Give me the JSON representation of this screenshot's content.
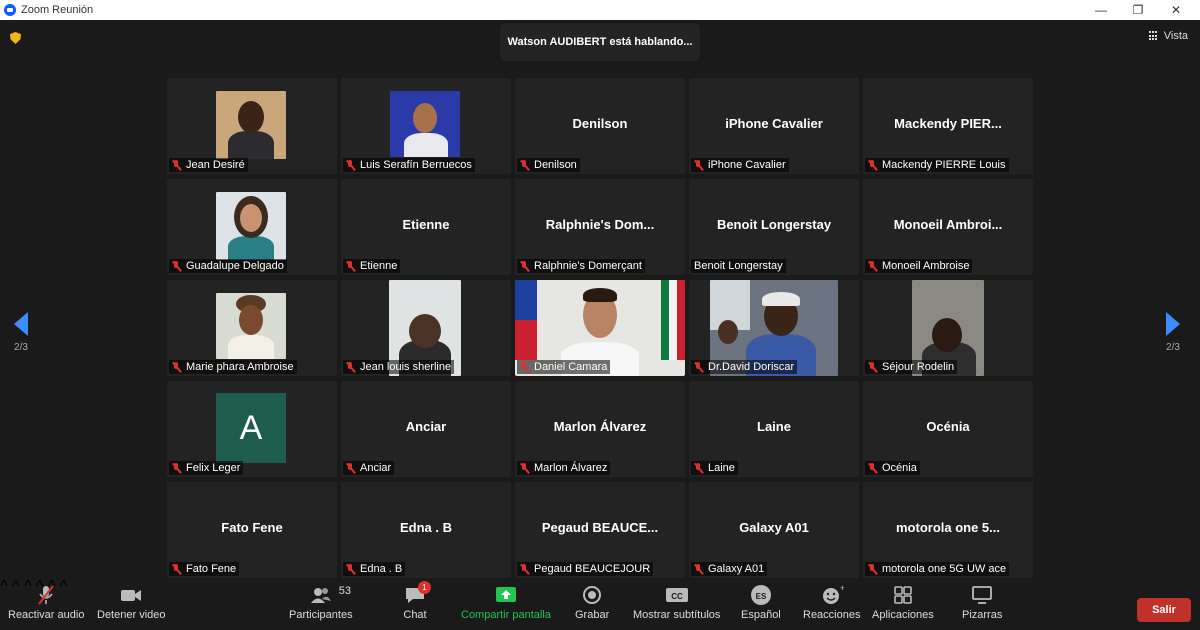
{
  "window": {
    "title": "Zoom Reunión",
    "minimize": "—",
    "maximize": "❐",
    "close": "✕"
  },
  "banner": "Watson AUDIBERT está hablando...",
  "view_label": "Vista",
  "pager": {
    "left": "2/3",
    "right": "2/3"
  },
  "tiles": [
    {
      "name": "Jean Desiré",
      "video": true,
      "muted": true
    },
    {
      "name": "Luis Serafín Berruecos",
      "video": true,
      "muted": true
    },
    {
      "name": "Denilson",
      "big": "Denilson",
      "muted": true
    },
    {
      "name": "iPhone Cavalier",
      "big": "iPhone Cavalier",
      "muted": true
    },
    {
      "name": "Mackendy PIERRE Louis",
      "big": "Mackendy  PIER...",
      "muted": true
    },
    {
      "name": "Guadalupe Delgado",
      "video": true,
      "muted": true
    },
    {
      "name": "Etienne",
      "big": "Etienne",
      "muted": true
    },
    {
      "name": "Ralphnie's Domerçant",
      "big": "Ralphnie's  Dom...",
      "muted": true
    },
    {
      "name": "Benoit Longerstay",
      "big": "Benoit Longerstay",
      "muted": false
    },
    {
      "name": "Monoeil Ambroise",
      "big": "Monoeil  Ambroi...",
      "muted": true
    },
    {
      "name": "Marie phara Ambroise",
      "video": true,
      "muted": true
    },
    {
      "name": "Jean louis sherline",
      "video": true,
      "muted": true
    },
    {
      "name": "Daniel Camara",
      "video": true,
      "muted": true
    },
    {
      "name": "Dr.David Doriscar",
      "video": true,
      "muted": true
    },
    {
      "name": "Séjour Rodelin",
      "video": true,
      "muted": true
    },
    {
      "name": "Felix Leger",
      "avatar": "A",
      "muted": true
    },
    {
      "name": "Anciar",
      "big": "Anciar",
      "muted": true
    },
    {
      "name": "Marlon Álvarez",
      "big": "Marlon Álvarez",
      "muted": true
    },
    {
      "name": "Laine",
      "big": "Laine",
      "muted": true
    },
    {
      "name": "Océnia",
      "big": "Océnia",
      "muted": true
    },
    {
      "name": "Fato Fene",
      "big": "Fato Fene",
      "muted": true
    },
    {
      "name": "Edna . B",
      "big": "Edna . B",
      "muted": true
    },
    {
      "name": "Pegaud BEAUCEJOUR",
      "big": "Pegaud  BEAUCE...",
      "muted": true
    },
    {
      "name": "Galaxy A01",
      "big": "Galaxy A01",
      "muted": true
    },
    {
      "name": "motorola one 5G UW ace",
      "big": "motorola  one  5...",
      "muted": true
    }
  ],
  "toolbar": {
    "audio": "Reactivar audio",
    "video": "Detener video",
    "participants": "Participantes",
    "participants_count": "53",
    "chat": "Chat",
    "chat_badge": "1",
    "share": "Compartir pantalla",
    "record": "Grabar",
    "captions": "Mostrar subtítulos",
    "captions_icon": "CC",
    "language": "Español",
    "language_icon": "ES",
    "reactions": "Reacciones",
    "apps": "Aplicaciones",
    "whiteboards": "Pizarras",
    "leave": "Salir"
  },
  "colors": {
    "accent": "#3b8cff",
    "leave": "#c0312b",
    "muted": "#e02f2f",
    "share": "#23c552"
  }
}
